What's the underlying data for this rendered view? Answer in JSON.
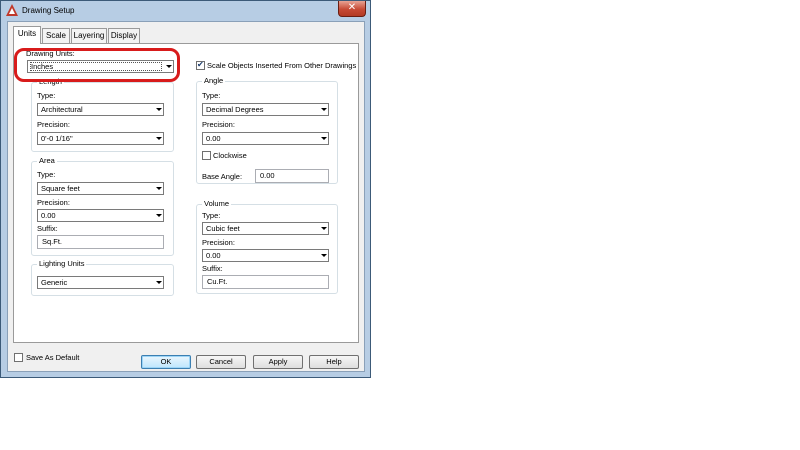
{
  "window": {
    "title": "Drawing Setup",
    "close_glyph": "✕"
  },
  "tabs": [
    {
      "label": "Units",
      "active": true
    },
    {
      "label": "Scale",
      "active": false
    },
    {
      "label": "Layering",
      "active": false
    },
    {
      "label": "Display",
      "active": false
    }
  ],
  "drawing_units": {
    "label": "Drawing Units:",
    "value": "Inches"
  },
  "scale_objects": {
    "label": "Scale Objects Inserted From Other Drawings",
    "checked": true
  },
  "length": {
    "title": "Length",
    "type_label": "Type:",
    "type_value": "Architectural",
    "precision_label": "Precision:",
    "precision_value": "0'-0 1/16\""
  },
  "angle": {
    "title": "Angle",
    "type_label": "Type:",
    "type_value": "Decimal Degrees",
    "precision_label": "Precision:",
    "precision_value": "0.00",
    "clockwise_label": "Clockwise",
    "clockwise_checked": false,
    "base_angle_label": "Base Angle:",
    "base_angle_value": "0.00"
  },
  "area": {
    "title": "Area",
    "type_label": "Type:",
    "type_value": "Square feet",
    "precision_label": "Precision:",
    "precision_value": "0.00",
    "suffix_label": "Suffix:",
    "suffix_value": "Sq.Ft."
  },
  "volume": {
    "title": "Volume",
    "type_label": "Type:",
    "type_value": "Cubic feet",
    "precision_label": "Precision:",
    "precision_value": "0.00",
    "suffix_label": "Suffix:",
    "suffix_value": "Cu.Ft."
  },
  "lighting": {
    "title": "Lighting Units",
    "value": "Generic"
  },
  "footer": {
    "save_default_label": "Save As Default",
    "save_default_checked": false,
    "ok": "OK",
    "cancel": "Cancel",
    "apply": "Apply",
    "help": "Help"
  },
  "colors": {
    "annotation": "#d81b1b",
    "titlebar": "#b7cde4",
    "close_button": "#c74a35"
  }
}
